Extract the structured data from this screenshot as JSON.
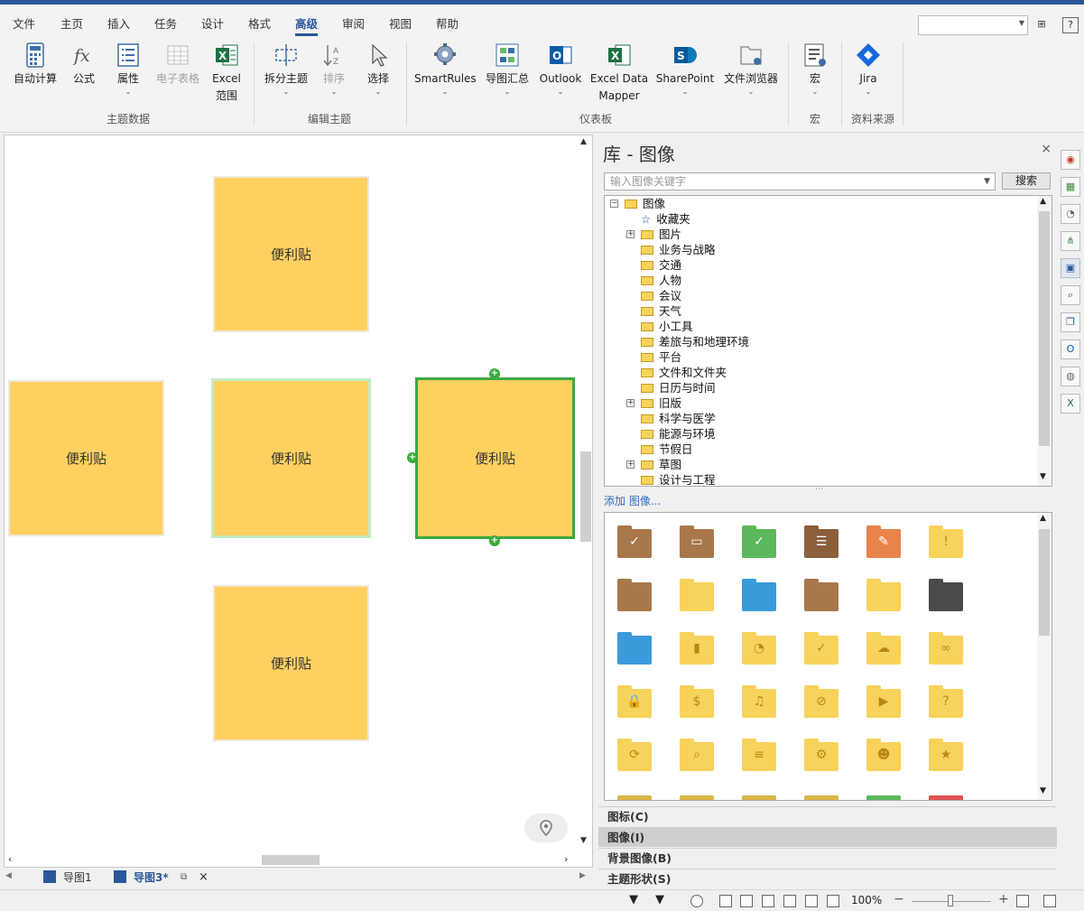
{
  "menu": {
    "tabs": [
      "文件",
      "主页",
      "插入",
      "任务",
      "设计",
      "格式",
      "高级",
      "审阅",
      "视图",
      "帮助"
    ],
    "active_tab": "高级",
    "help_icon": "?"
  },
  "ribbon": {
    "buttons": {
      "auto_calc": "自动计算",
      "formula": "公式",
      "attribute": "属性",
      "spreadsheet": "电子表格",
      "excel_range_1": "Excel",
      "excel_range_2": "范围",
      "split_topic": "拆分主题",
      "sort": "排序",
      "select": "选择",
      "smartrules": "SmartRules",
      "map_summary": "导图汇总",
      "outlook": "Outlook",
      "excel_mapper_1": "Excel Data",
      "excel_mapper_2": "Mapper",
      "sharepoint": "SharePoint",
      "file_browser": "文件浏览器",
      "macro": "宏",
      "jira": "Jira"
    },
    "groups": {
      "topic_data": "主题数据",
      "edit_topic": "编辑主题",
      "dashboard": "仪表板",
      "macro": "宏",
      "sources": "资料来源"
    }
  },
  "canvas": {
    "notes": [
      "便利贴",
      "便利贴",
      "便利贴",
      "便利贴",
      "便利贴"
    ],
    "handle_plus": "+"
  },
  "doc_tabs": {
    "tab1": "导图1",
    "tab2": "导图3*",
    "close": "×"
  },
  "panel": {
    "title": "库 - 图像",
    "close": "×",
    "search_placeholder": "输入图像关键字",
    "search_button": "搜索",
    "tree": [
      {
        "label": "图像",
        "expander": "⊟",
        "level": 0
      },
      {
        "label": "收藏夹",
        "expander": "",
        "level": 1
      },
      {
        "label": "图片",
        "expander": "+",
        "level": 1
      },
      {
        "label": "业务与战略",
        "expander": "",
        "level": 1
      },
      {
        "label": "交通",
        "expander": "",
        "level": 1
      },
      {
        "label": "人物",
        "expander": "",
        "level": 1
      },
      {
        "label": "会议",
        "expander": "",
        "level": 1
      },
      {
        "label": "天气",
        "expander": "",
        "level": 1
      },
      {
        "label": "小工具",
        "expander": "",
        "level": 1
      },
      {
        "label": "差旅与和地理环境",
        "expander": "",
        "level": 1
      },
      {
        "label": "平台",
        "expander": "",
        "level": 1
      },
      {
        "label": "文件和文件夹",
        "expander": "",
        "level": 1
      },
      {
        "label": "日历与时间",
        "expander": "",
        "level": 1
      },
      {
        "label": "旧版",
        "expander": "+",
        "level": 1
      },
      {
        "label": "科学与医学",
        "expander": "",
        "level": 1
      },
      {
        "label": "能源与环境",
        "expander": "",
        "level": 1
      },
      {
        "label": "节假日",
        "expander": "",
        "level": 1
      },
      {
        "label": "草图",
        "expander": "+",
        "level": 1
      },
      {
        "label": "设计与工程",
        "expander": "",
        "level": 1
      }
    ],
    "add_link": "添加 图像...",
    "gallery_icons": [
      "inbox-check-icon",
      "archive-box-icon",
      "green-check-document-icon",
      "drawer-cabinet-icon",
      "orange-edit-document-icon",
      "yellow-alert-document-icon",
      "brown-folder-icon",
      "yellow-folder-icon",
      "blue-folder-icon",
      "brown-open-folder-icon",
      "yellow-open-folder-icon",
      "dark-folder-icon",
      "blue-open-folder-icon",
      "chart-folder-icon",
      "pie-folder-icon",
      "check-folder-icon",
      "cloud-folder-icon",
      "link-folder-icon",
      "lock-folder-icon",
      "dollar-folder-icon",
      "music-folder-icon",
      "blocked-folder-icon",
      "play-folder-icon",
      "question-folder-icon",
      "sync-folder-icon",
      "search-folder-icon",
      "sliders-folder-icon",
      "gear-folder-icon",
      "people-folder-icon",
      "star-folder-icon"
    ],
    "accordion": [
      "图标(C)",
      "图像(I)",
      "背景图像(B)",
      "主题形状(S)"
    ],
    "accordion_active": "图像(I)"
  },
  "status": {
    "zoom": "100%"
  }
}
